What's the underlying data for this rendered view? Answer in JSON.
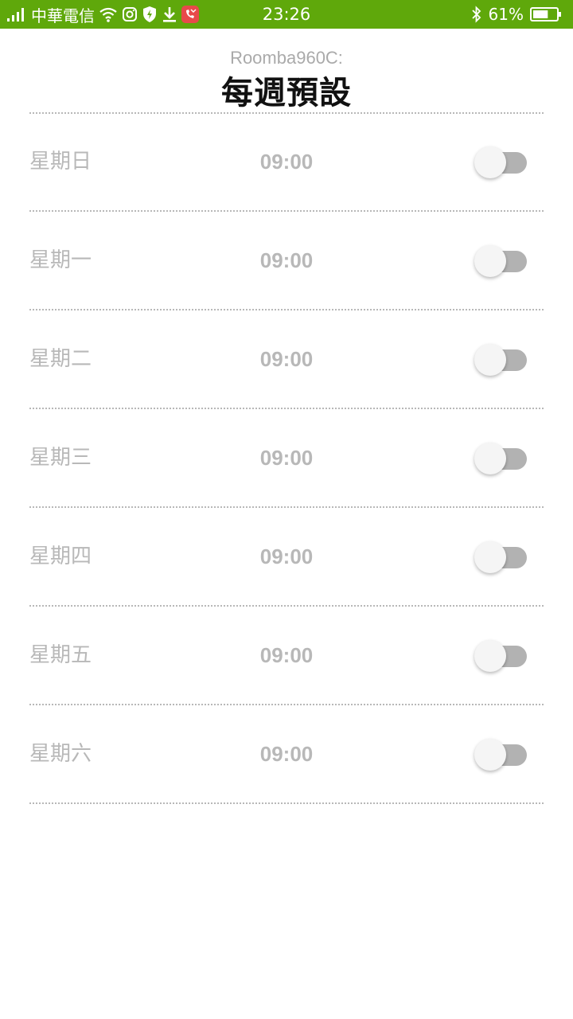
{
  "status_bar": {
    "carrier": "中華電信",
    "time": "23:26",
    "battery_percent": "61%",
    "battery_level": 0.61,
    "background_color": "#5fa80b",
    "icons_left": [
      "signal-icon",
      "wifi-icon",
      "instagram-icon",
      "shield-icon",
      "download-icon",
      "missed-call-icon"
    ],
    "icons_right": [
      "bluetooth-icon",
      "battery-icon"
    ]
  },
  "header": {
    "device_name": "Roomba960C:",
    "title": "每週預設"
  },
  "schedule": [
    {
      "day": "星期日",
      "time": "09:00",
      "enabled": false
    },
    {
      "day": "星期一",
      "time": "09:00",
      "enabled": false
    },
    {
      "day": "星期二",
      "time": "09:00",
      "enabled": false
    },
    {
      "day": "星期三",
      "time": "09:00",
      "enabled": false
    },
    {
      "day": "星期四",
      "time": "09:00",
      "enabled": false
    },
    {
      "day": "星期五",
      "time": "09:00",
      "enabled": false
    },
    {
      "day": "星期六",
      "time": "09:00",
      "enabled": false
    }
  ],
  "colors": {
    "muted_text": "#b8b8b8",
    "title_text": "#111111",
    "toggle_track_off": "#b2b2b2"
  }
}
